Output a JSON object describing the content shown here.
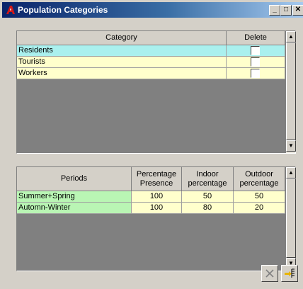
{
  "window": {
    "title": "Population Categories",
    "buttons": {
      "minimize": "_",
      "maximize": "□",
      "close": "✕"
    }
  },
  "colors": {
    "selected_row": "#aaf0ee",
    "row": "#ffffcc",
    "period_name_cell": "#b9f5b4",
    "period_value_cell": "#ffffcc"
  },
  "categories": {
    "headers": {
      "category": "Category",
      "delete": "Delete"
    },
    "rows": [
      {
        "name": "Residents",
        "delete": false,
        "selected": true
      },
      {
        "name": "Tourists",
        "delete": false,
        "selected": false
      },
      {
        "name": "Workers",
        "delete": false,
        "selected": false
      }
    ]
  },
  "periods": {
    "headers": {
      "periods": "Periods",
      "percentage_presence": "Percentage Presence",
      "indoor": "Indoor percentage",
      "outdoor": "Outdoor percentage"
    },
    "rows": [
      {
        "name": "Summer+Spring",
        "presence": "100",
        "indoor": "50",
        "outdoor": "50"
      },
      {
        "name": "Automn-Winter",
        "presence": "100",
        "indoor": "80",
        "outdoor": "20"
      }
    ]
  },
  "footer": {
    "delete_icon": "delete-x-icon",
    "confirm_icon": "apply-icon"
  }
}
